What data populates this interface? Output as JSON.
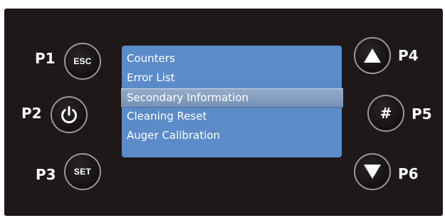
{
  "panel": {
    "labels": {
      "p1": "P1",
      "p2": "P2",
      "p3": "P3",
      "p4": "P4",
      "p5": "P5",
      "p6": "P6"
    },
    "buttons": {
      "esc": {
        "label": "ESC",
        "icon": "esc-text"
      },
      "power": {
        "icon": "power-icon"
      },
      "set": {
        "label": "SET",
        "icon": "set-text"
      },
      "up": {
        "icon": "triangle-up-icon"
      },
      "hash": {
        "label": "#",
        "icon": "hash-text"
      },
      "down": {
        "icon": "triangle-down-icon"
      }
    }
  },
  "screen": {
    "menu": [
      {
        "label": "Counters",
        "selected": false
      },
      {
        "label": "Error List",
        "selected": false
      },
      {
        "label": "Secondary Information",
        "selected": true
      },
      {
        "label": "Cleaning Reset",
        "selected": false
      },
      {
        "label": "Auger Calibration",
        "selected": false
      }
    ]
  },
  "colors": {
    "panel_background": "#1e1918",
    "screen_background": "#5b8bc8",
    "selected_highlight": "#8aa2c2",
    "button_ring": "#9a9796",
    "text": "#ffffff"
  }
}
